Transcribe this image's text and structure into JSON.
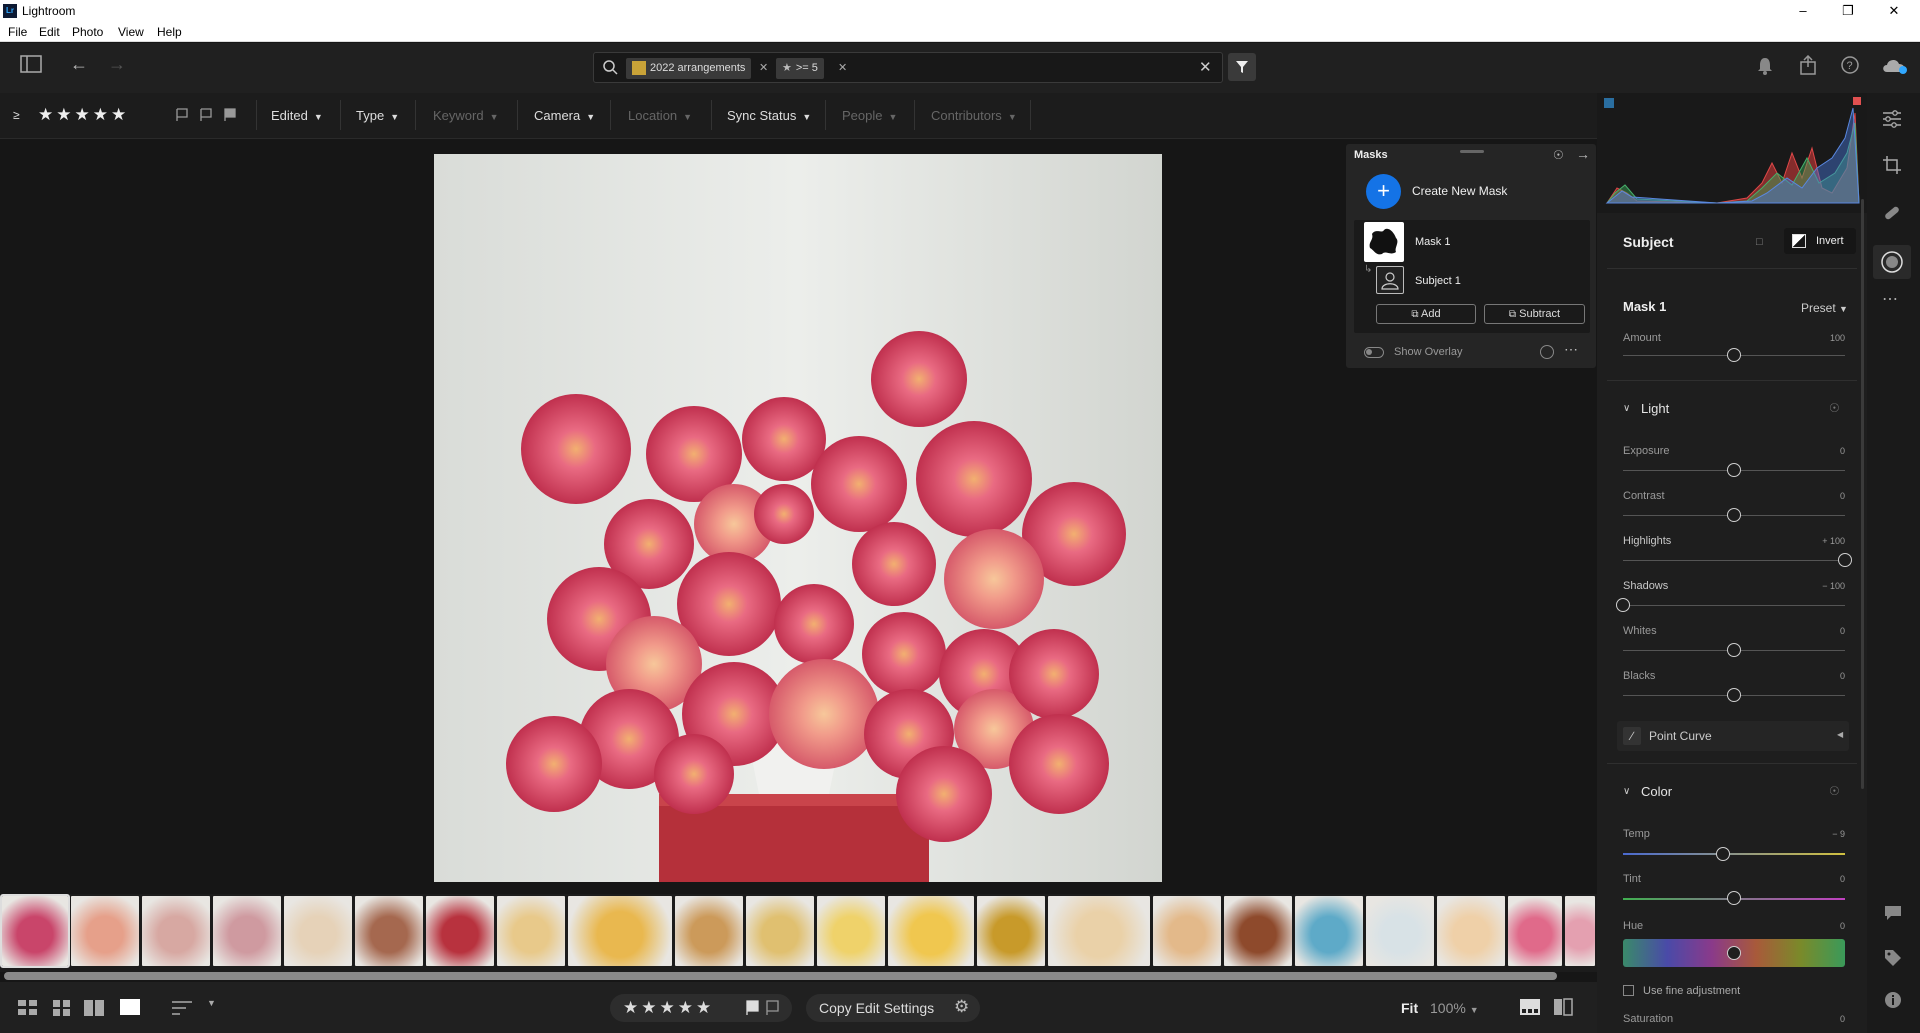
{
  "app": {
    "title": "Lightroom"
  },
  "menu": [
    "File",
    "Edit",
    "Photo",
    "View",
    "Help"
  ],
  "search": {
    "chips": [
      {
        "label": "2022 arrangements"
      },
      {
        "label": ">= 5"
      }
    ]
  },
  "filters": {
    "rating_operator": "≥",
    "items": [
      {
        "label": "Edited",
        "enabled": true
      },
      {
        "label": "Type",
        "enabled": true
      },
      {
        "label": "Keyword",
        "enabled": false
      },
      {
        "label": "Camera",
        "enabled": true
      },
      {
        "label": "Location",
        "enabled": false
      },
      {
        "label": "Sync Status",
        "enabled": true
      },
      {
        "label": "People",
        "enabled": false
      },
      {
        "label": "Contributors",
        "enabled": false
      }
    ]
  },
  "masks": {
    "title": "Masks",
    "create_label": "Create New Mask",
    "mask_name": "Mask 1",
    "component_name": "Subject 1",
    "add_label": "Add",
    "subtract_label": "Subtract",
    "overlay_label": "Show Overlay"
  },
  "panel": {
    "header": "Subject",
    "invert_label": "Invert",
    "mask_title": "Mask 1",
    "preset_label": "Preset",
    "amount": {
      "label": "Amount",
      "value": "100",
      "level": 0.5
    },
    "light": {
      "title": "Light",
      "sliders": [
        {
          "label": "Exposure",
          "value": "0",
          "level": 0.5
        },
        {
          "label": "Contrast",
          "value": "0",
          "level": 0.5
        },
        {
          "label": "Highlights",
          "value": "+ 100",
          "level": 1.0
        },
        {
          "label": "Shadows",
          "value": "− 100",
          "level": 0.0
        },
        {
          "label": "Whites",
          "value": "0",
          "level": 0.5
        },
        {
          "label": "Blacks",
          "value": "0",
          "level": 0.5
        }
      ]
    },
    "point_curve_label": "Point Curve",
    "color": {
      "title": "Color",
      "temp": {
        "label": "Temp",
        "value": "− 9",
        "level": 0.45
      },
      "tint": {
        "label": "Tint",
        "value": "0",
        "level": 0.5
      },
      "hue": {
        "label": "Hue",
        "value": "0",
        "level": 0.5
      },
      "fine_label": "Use fine adjustment",
      "saturation": {
        "label": "Saturation",
        "value": "0"
      }
    }
  },
  "bottom": {
    "copy_edit_label": "Copy Edit Settings",
    "fit_label": "Fit",
    "zoom_label": "100%"
  },
  "filmstrip": {
    "thumbs": [
      {
        "color": "#c9456a"
      },
      {
        "color": "#e6a08a"
      },
      {
        "color": "#d7a8a2"
      },
      {
        "color": "#cf9aa0"
      },
      {
        "color": "#e6d2b8"
      },
      {
        "color": "#a5684f"
      },
      {
        "color": "#b8323e"
      },
      {
        "color": "#e8c98a"
      },
      {
        "color": "#e9b84f"
      },
      {
        "color": "#cc9a5a"
      },
      {
        "color": "#e0c070"
      },
      {
        "color": "#efd26a"
      },
      {
        "color": "#f0c74f"
      },
      {
        "color": "#c89a2a"
      },
      {
        "color": "#ead1a8"
      },
      {
        "color": "#e3b98a"
      },
      {
        "color": "#8e4a2c"
      },
      {
        "color": "#5eaac8"
      },
      {
        "color": "#d8e2e6"
      },
      {
        "color": "#efd0a8"
      },
      {
        "color": "#e06a8a"
      },
      {
        "color": "#e4a0b0"
      }
    ]
  }
}
